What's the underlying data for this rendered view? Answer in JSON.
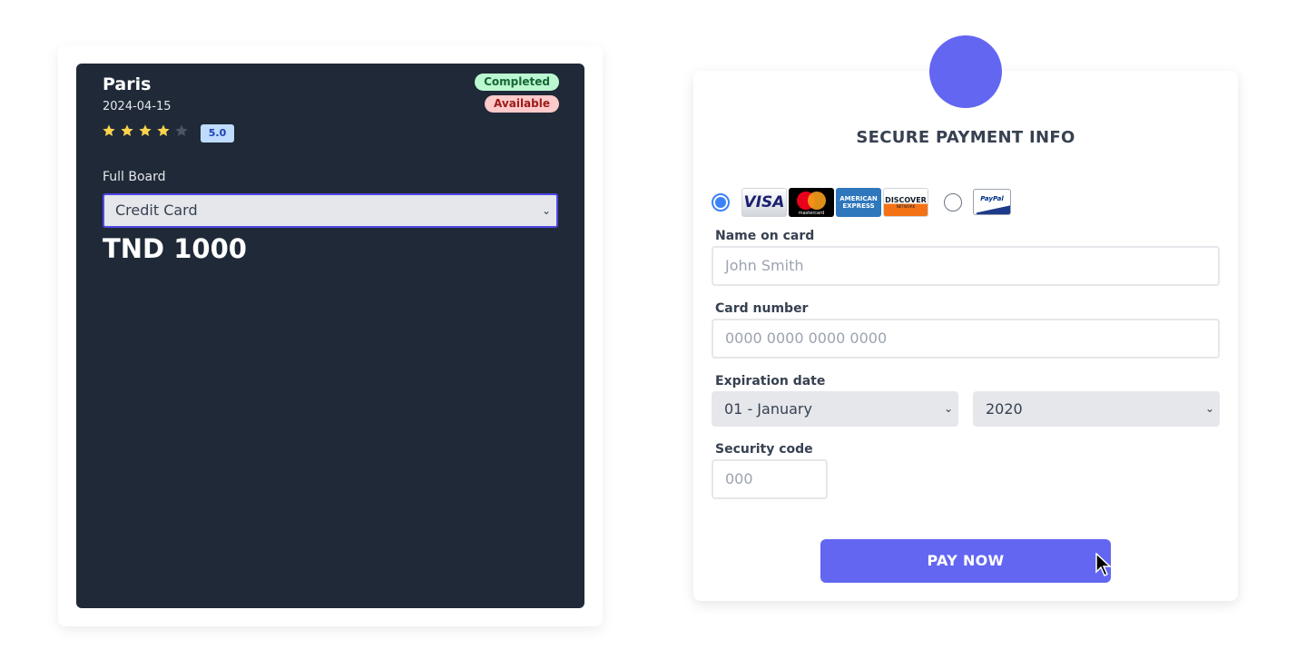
{
  "booking": {
    "city": "Paris",
    "date": "2024-04-15",
    "rating": 4,
    "rating_max": 5,
    "rating_label": "5.0",
    "badge_completed": "Completed",
    "badge_available": "Available",
    "board_label": "Full Board",
    "payment_select_value": "Credit Card",
    "price": "TND 1000"
  },
  "payment": {
    "title": "SECURE PAYMENT INFO",
    "method_selected": "card",
    "card_logos": [
      "VISA",
      "mastercard",
      "AMERICAN EXPRESS",
      "DISCOVER",
      "NETWORK"
    ],
    "paypal_logo": "PayPal",
    "name_label": "Name on card",
    "name_placeholder": "John Smith",
    "card_label": "Card number",
    "card_placeholder": "0000 0000 0000 0000",
    "exp_label": "Expiration date",
    "exp_month": "01 - January",
    "exp_year": "2020",
    "sec_label": "Security code",
    "sec_placeholder": "000",
    "pay_button": "PAY NOW"
  },
  "colors": {
    "accent": "#6366f1",
    "card_bg": "#1f2937",
    "star_filled": "#fcd34d",
    "star_empty": "#4b5563"
  },
  "icons": {
    "chevron": "chevron-down-icon",
    "star": "star-icon",
    "cursor": "mouse-cursor-icon"
  }
}
